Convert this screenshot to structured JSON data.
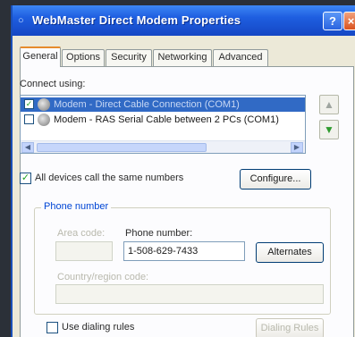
{
  "window": {
    "title": "WebMaster Direct Modem Properties",
    "help_glyph": "?",
    "close_glyph": "×"
  },
  "tabs": [
    {
      "label": "General",
      "active": true
    },
    {
      "label": "Options"
    },
    {
      "label": "Security"
    },
    {
      "label": "Networking"
    },
    {
      "label": "Advanced"
    }
  ],
  "connect_using": {
    "label": "Connect using:",
    "devices": [
      {
        "label": "Modem - Direct Cable Connection (COM1)",
        "checked": true,
        "selected": true
      },
      {
        "label": "Modem - RAS Serial Cable between 2 PCs (COM1)",
        "checked": false,
        "selected": false
      }
    ]
  },
  "side_buttons": {
    "up_glyph": "▲",
    "down_glyph": "▼"
  },
  "all_devices": {
    "label": "All devices call the same numbers",
    "checked": true
  },
  "configure_button": "Configure...",
  "phone_group": {
    "title": "Phone number",
    "area_code_label": "Area code:",
    "phone_label": "Phone number:",
    "phone_value": "1-508-629-7433",
    "alternates_button": "Alternates",
    "country_label": "Country/region code:",
    "use_dialing_rules": {
      "label": "Use dialing rules",
      "checked": false
    },
    "dialing_rules_button": "Dialing Rules"
  },
  "colors": {
    "title_bar": "#1e5ee0",
    "accent": "#e68b2c",
    "selection": "#316ac5"
  }
}
